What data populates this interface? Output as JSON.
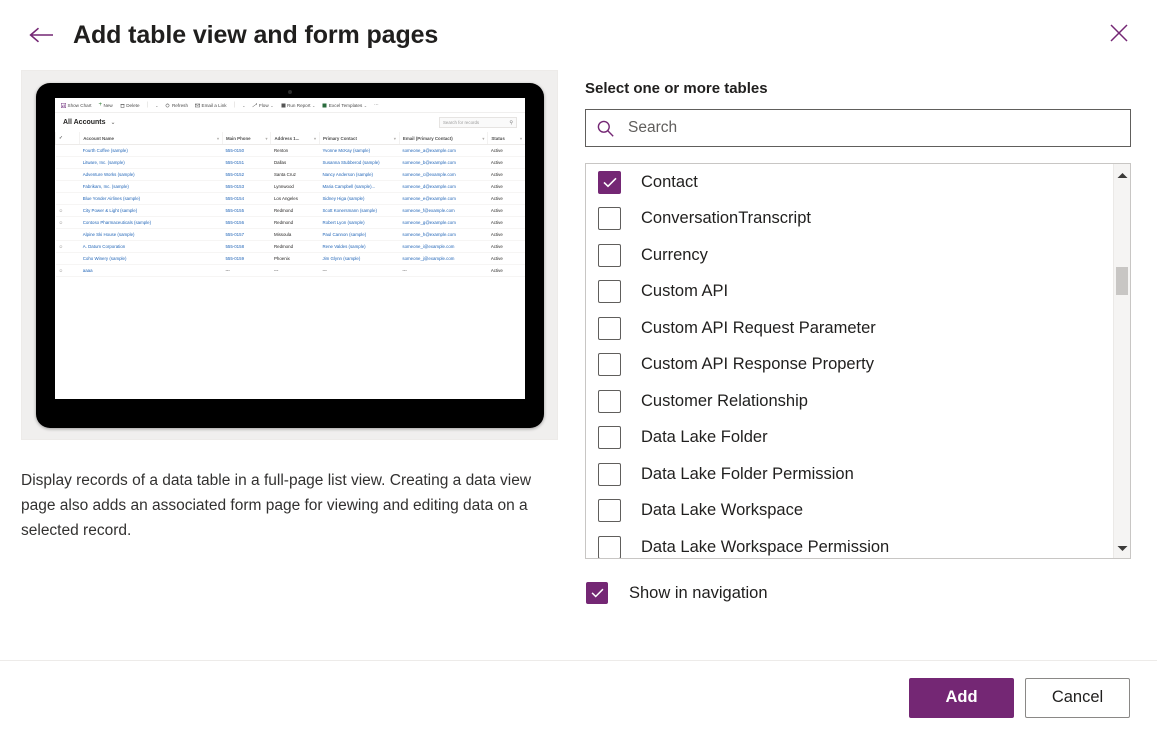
{
  "header": {
    "title": "Add table view and form pages",
    "back_icon": "arrow-left-icon",
    "close_icon": "close-icon",
    "accent_color": "#742774"
  },
  "preview": {
    "alt": "tablet-preview-of-table-view-page",
    "app": {
      "toolbar": [
        {
          "label": "Show Chart",
          "icon": "chart-icon",
          "caret": false
        },
        {
          "label": "New",
          "icon": "plus-icon",
          "caret": false
        },
        {
          "label": "Delete",
          "icon": "trash-icon",
          "caret": true
        },
        {
          "label": "Refresh",
          "icon": "refresh-icon",
          "caret": false
        },
        {
          "label": "Email a Link",
          "icon": "mail-icon",
          "caret": true
        },
        {
          "label": "Flow",
          "icon": "flow-icon",
          "caret": true
        },
        {
          "label": "Run Report",
          "icon": "report-icon",
          "caret": true
        },
        {
          "label": "Excel Templates",
          "icon": "excel-icon",
          "caret": true
        },
        {
          "label": "⋯",
          "icon": "overflow-icon",
          "caret": false
        }
      ],
      "view_name": "All Accounts",
      "search_placeholder": "Search for records",
      "columns": [
        "Account Name",
        "Main Phone",
        "Address 1...",
        "Primary Contact",
        "Email (Primary Contact)",
        "Status"
      ],
      "rows": [
        {
          "icon": "",
          "name": "Fourth Coffee (sample)",
          "phone": "555-0150",
          "address": "Renton",
          "contact": "Yvonne McKay (sample)",
          "email": "someone_a@example.com",
          "status": "Active"
        },
        {
          "icon": "",
          "name": "Litware, Inc. (sample)",
          "phone": "555-0151",
          "address": "Dallas",
          "contact": "Susanna Stubberod (sample)",
          "email": "someone_b@example.com",
          "status": "Active"
        },
        {
          "icon": "",
          "name": "Adventure Works (sample)",
          "phone": "555-0152",
          "address": "Santa Cruz",
          "contact": "Nancy Anderson (sample)",
          "email": "someone_c@example.com",
          "status": "Active"
        },
        {
          "icon": "",
          "name": "Fabrikam, Inc. (sample)",
          "phone": "555-0153",
          "address": "Lynnwood",
          "contact": "Maria Campbell (sample)...",
          "email": "someone_d@example.com",
          "status": "Active"
        },
        {
          "icon": "",
          "name": "Blue Yonder Airlines (sample)",
          "phone": "555-0154",
          "address": "Los Angeles",
          "contact": "Sidney Higa (sample)",
          "email": "someone_e@example.com",
          "status": "Active"
        },
        {
          "icon": "person-icon",
          "name": "City Power & Light (sample)",
          "phone": "555-0155",
          "address": "Redmond",
          "contact": "Scott Konersmann (sample)",
          "email": "someone_f@example.com",
          "status": "Active"
        },
        {
          "icon": "person-icon",
          "name": "Contoso Pharmaceuticals (sample)",
          "phone": "555-0156",
          "address": "Redmond",
          "contact": "Robert Lyon (sample)",
          "email": "someone_g@example.com",
          "status": "Active"
        },
        {
          "icon": "",
          "name": "Alpine Ski House (sample)",
          "phone": "555-0157",
          "address": "Missoula",
          "contact": "Paul Cannon (sample)",
          "email": "someone_h@example.com",
          "status": "Active"
        },
        {
          "icon": "person-icon",
          "name": "A. Datum Corporation",
          "phone": "555-0158",
          "address": "Redmond",
          "contact": "Rene Valdes (sample)",
          "email": "someone_i@example.com",
          "status": "Active"
        },
        {
          "icon": "",
          "name": "Coho Winery (sample)",
          "phone": "555-0159",
          "address": "Phoenix",
          "contact": "Jim Glynn (sample)",
          "email": "someone_j@example.com",
          "status": "Active"
        },
        {
          "icon": "person-icon",
          "name": "aaaa",
          "phone": "---",
          "address": "---",
          "contact": "---",
          "email": "---",
          "status": "Active"
        }
      ]
    },
    "description": "Display records of a data table in a full-page list view. Creating a data view page also adds an associated form page for viewing and editing data on a selected record."
  },
  "select_tables": {
    "label": "Select one or more tables",
    "search_placeholder": "Search",
    "search_value": "",
    "search_icon": "search-icon",
    "scroll_up_icon": "chevron-up-icon",
    "scroll_down_icon": "chevron-down-icon",
    "items": [
      {
        "label": "Contact",
        "checked": true
      },
      {
        "label": "ConversationTranscript",
        "checked": false
      },
      {
        "label": "Currency",
        "checked": false
      },
      {
        "label": "Custom API",
        "checked": false
      },
      {
        "label": "Custom API Request Parameter",
        "checked": false
      },
      {
        "label": "Custom API Response Property",
        "checked": false
      },
      {
        "label": "Customer Relationship",
        "checked": false
      },
      {
        "label": "Data Lake Folder",
        "checked": false
      },
      {
        "label": "Data Lake Folder Permission",
        "checked": false
      },
      {
        "label": "Data Lake Workspace",
        "checked": false
      },
      {
        "label": "Data Lake Workspace Permission",
        "checked": false
      }
    ]
  },
  "show_in_navigation": {
    "label": "Show in navigation",
    "checked": true
  },
  "footer": {
    "add_label": "Add",
    "cancel_label": "Cancel"
  }
}
